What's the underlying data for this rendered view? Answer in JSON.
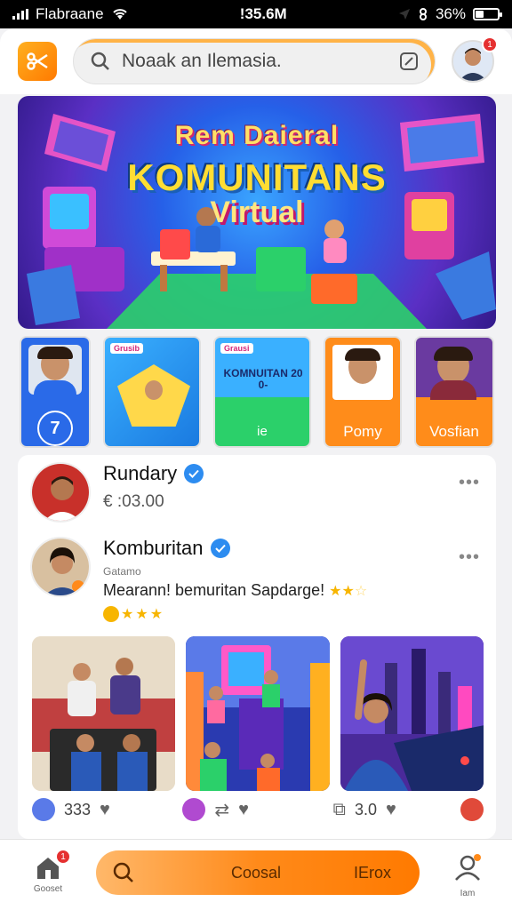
{
  "status_bar": {
    "carrier": "Flabraane",
    "time": "!35.6M",
    "battery": "36%",
    "battery_level": 0.36
  },
  "header": {
    "search_placeholder": "Noaak an Ilemasia.",
    "notification_count": "1"
  },
  "banner": {
    "line1": "Rem Daieral",
    "line2": "KOMUNITANS",
    "line3": "Virtual"
  },
  "stories": [
    {
      "tag": "",
      "label": "7"
    },
    {
      "tag": "Grusib",
      "label": ""
    },
    {
      "tag": "Grausi",
      "label": "KOMNUITAN 20 0-",
      "footer": "ie"
    },
    {
      "tag": "",
      "label": "Pomy"
    },
    {
      "tag": "",
      "label": "Vosfian"
    }
  ],
  "posts": [
    {
      "name": "Rundary",
      "meta": "€ :03.00",
      "verified": true
    },
    {
      "name": "Komburitan",
      "sub": "Gatamo",
      "text": "Mearann! bemuritan Sapdarge!",
      "verified": true
    }
  ],
  "media_actions": [
    {
      "count": "333"
    },
    {
      "count": ""
    },
    {
      "count": "3.0"
    }
  ],
  "bottom_nav": {
    "home_label": "Gooset",
    "home_badge": "1",
    "pill_label_1": "Coosal",
    "pill_label_2": "IErox",
    "profile_label": "Iam"
  },
  "colors": {
    "accent": "#ff8a1a",
    "verified": "#2d8cf0",
    "badge": "#e53030"
  }
}
